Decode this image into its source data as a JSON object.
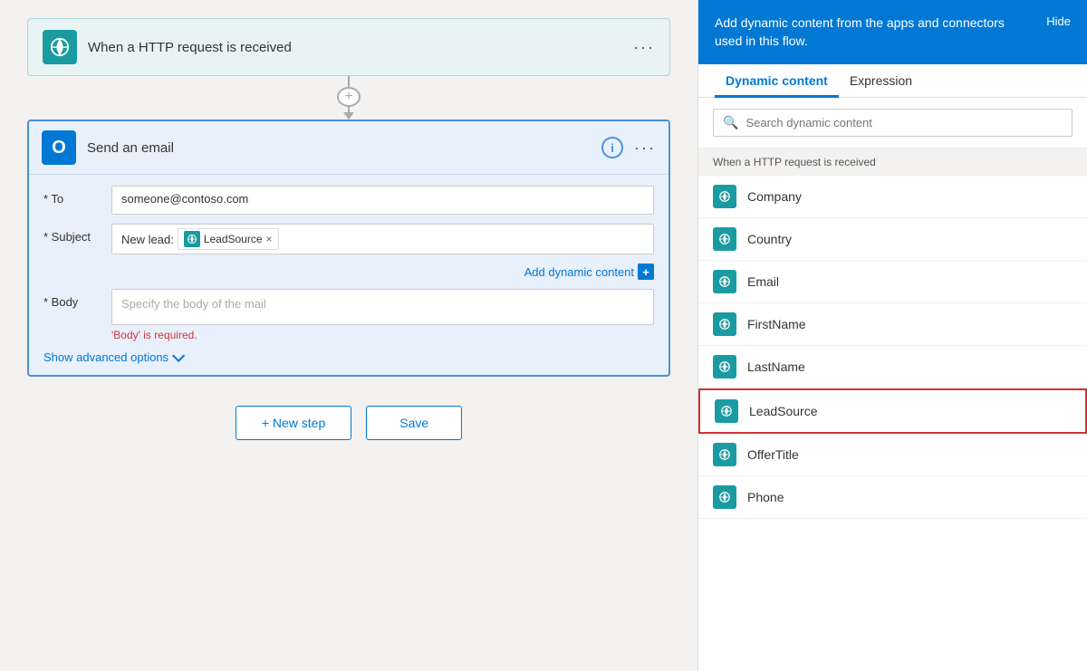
{
  "httpBlock": {
    "title": "When a HTTP request is received",
    "moreLabel": "···"
  },
  "emailBlock": {
    "title": "Send an email",
    "fields": {
      "toLabel": "* To",
      "toValue": "someone@contoso.com",
      "subjectLabel": "* Subject",
      "subjectPrefix": "New lead:",
      "leadTagName": "LeadSource",
      "bodyLabel": "* Body",
      "bodyPlaceholder": "Specify the body of the mail",
      "bodyError": "'Body' is required.",
      "addDynamicLabel": "Add dynamic content",
      "showAdvancedLabel": "Show advanced options"
    }
  },
  "actions": {
    "newStepLabel": "+ New step",
    "saveLabel": "Save"
  },
  "rightPanel": {
    "headerText": "Add dynamic content from the apps and connectors used in this flow.",
    "hideLabel": "Hide",
    "tabs": [
      {
        "label": "Dynamic content",
        "active": true
      },
      {
        "label": "Expression",
        "active": false
      }
    ],
    "searchPlaceholder": "Search dynamic content",
    "sectionHeader": "When a HTTP request is received",
    "items": [
      {
        "label": "Company",
        "highlighted": false
      },
      {
        "label": "Country",
        "highlighted": false
      },
      {
        "label": "Email",
        "highlighted": false
      },
      {
        "label": "FirstName",
        "highlighted": false
      },
      {
        "label": "LastName",
        "highlighted": false
      },
      {
        "label": "LeadSource",
        "highlighted": true
      },
      {
        "label": "OfferTitle",
        "highlighted": false
      },
      {
        "label": "Phone",
        "highlighted": false
      }
    ]
  }
}
